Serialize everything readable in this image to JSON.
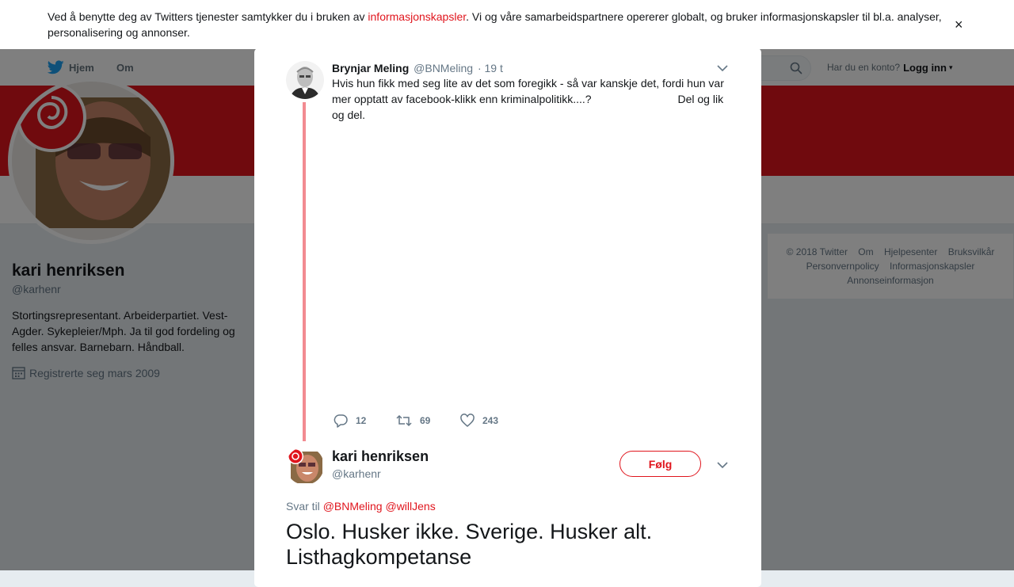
{
  "colors": {
    "accent": "#e0151d",
    "twitter_blue": "#1da1f2",
    "thread_line": "#f28b91"
  },
  "cookie_bar": {
    "text_before": "Ved å benytte deg av Twitters tjenester samtykker du i bruken av ",
    "link": "informasjonskapsler",
    "text_after": ". Vi og våre samarbeidspartnere opererer globalt, og bruker informasjonskapsler til bl.a. analyser, personalisering og annonser.",
    "close": "×"
  },
  "modal_close": "✕",
  "nav": {
    "home": "Hjem",
    "about": "Om",
    "account_prompt": "Har du en konto?",
    "login": "Logg inn",
    "caret": "▾",
    "icons": {
      "logo": "twitter-bird-icon",
      "search": "search-icon"
    }
  },
  "profile": {
    "name": "kari henriksen",
    "handle": "@karhenr",
    "bio": "Stortingsrepresentant. Arbeiderpartiet. Vest-Agder. Sykepleier/Mph. Ja til god fordeling og felles ansvar. Barnebarn. Håndball.",
    "joined": "Registrerte seg mars 2009"
  },
  "footer": {
    "links": [
      "© 2018 Twitter",
      "Om",
      "Hjelpesenter",
      "Bruksvilkår",
      "Personvernpolicy",
      "Informasjonskapsler",
      "Annonseinformasjon"
    ]
  },
  "modal": {
    "tweet1": {
      "name": "Brynjar Meling",
      "handle": "@BNMeling",
      "dot": "·",
      "time": "19 t",
      "text": "Hvis hun fikk med seg lite av det som foregikk - så var kanskje det, fordi hun var mer opptatt av facebook-klikk enn kriminalpolitikk....?                            Del og lik og del.",
      "replies": "12",
      "retweets": "69",
      "likes": "243"
    },
    "tweet2": {
      "name": "kari henriksen",
      "handle": "@karhenr",
      "follow": "Følg",
      "reply_label": "Svar til",
      "mention1": "@BNMeling",
      "mention2": "@willJens",
      "text": "Oslo. Husker ikke. Sverige. Husker alt. Listhagkompetanse"
    }
  }
}
